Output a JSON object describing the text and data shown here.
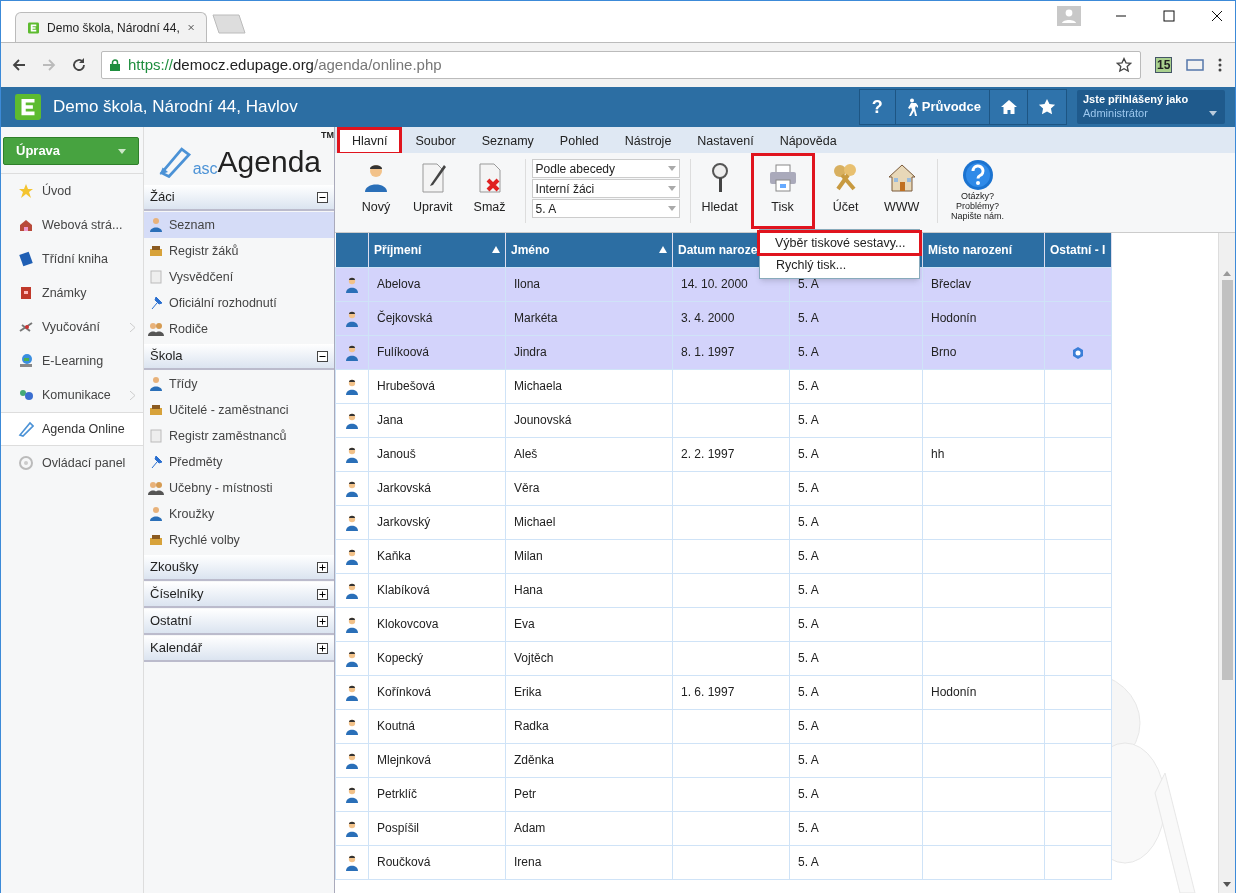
{
  "browser": {
    "tab_title": "Demo škola, Národní 44,",
    "url_scheme": "https://",
    "url_host": "democz.edupage.org",
    "url_path": "/agenda/online.php",
    "extension_badge": "15"
  },
  "header": {
    "title": "Demo škola, Národní 44, Havlov",
    "help": "?",
    "guide": "Průvodce",
    "user_label": "Jste přihlášený jako",
    "user_name": "Administrátor"
  },
  "nav": {
    "edit_button": "Úprava",
    "items": [
      {
        "label": "Úvod",
        "selected": false,
        "submenu": false
      },
      {
        "label": "Webová strá...",
        "selected": false,
        "submenu": false
      },
      {
        "label": "Třídní kniha",
        "selected": false,
        "submenu": false
      },
      {
        "label": "Známky",
        "selected": false,
        "submenu": false
      },
      {
        "label": "Vyučování",
        "selected": false,
        "submenu": true
      },
      {
        "label": "E-Learning",
        "selected": false,
        "submenu": false
      },
      {
        "label": "Komunikace",
        "selected": false,
        "submenu": true
      },
      {
        "label": "Agenda Online",
        "selected": true,
        "submenu": false
      },
      {
        "label": "Ovládací panel",
        "selected": false,
        "submenu": false
      }
    ]
  },
  "logo": {
    "prefix": "asc",
    "name": "Agenda",
    "mark": "TM"
  },
  "sections": [
    {
      "title": "Žáci",
      "expanded": true,
      "items": [
        {
          "label": "Seznam",
          "selected": true
        },
        {
          "label": "Registr žáků",
          "selected": false
        },
        {
          "label": "Vysvědčení",
          "selected": false
        },
        {
          "label": "Oficiální rozhodnutí",
          "selected": false
        },
        {
          "label": "Rodiče",
          "selected": false
        }
      ]
    },
    {
      "title": "Škola",
      "expanded": true,
      "items": [
        {
          "label": "Třídy",
          "selected": false
        },
        {
          "label": "Učitelé - zaměstnanci",
          "selected": false
        },
        {
          "label": "Registr zaměstnanců",
          "selected": false
        },
        {
          "label": "Předměty",
          "selected": false
        },
        {
          "label": "Učebny - místnosti",
          "selected": false
        },
        {
          "label": "Kroužky",
          "selected": false
        },
        {
          "label": "Rychlé volby",
          "selected": false
        }
      ]
    },
    {
      "title": "Zkoušky",
      "expanded": false
    },
    {
      "title": "Číselníky",
      "expanded": false
    },
    {
      "title": "Ostatní",
      "expanded": false
    },
    {
      "title": "Kalendář",
      "expanded": false
    }
  ],
  "menu_tabs": [
    {
      "label": "Hlavní",
      "selected": true,
      "highlighted": true
    },
    {
      "label": "Soubor",
      "selected": false,
      "highlighted": false
    },
    {
      "label": "Seznamy",
      "selected": false,
      "highlighted": false
    },
    {
      "label": "Pohled",
      "selected": false,
      "highlighted": false
    },
    {
      "label": "Nástroje",
      "selected": false,
      "highlighted": false
    },
    {
      "label": "Nastavení",
      "selected": false,
      "highlighted": false
    },
    {
      "label": "Nápověda",
      "selected": false,
      "highlighted": false
    }
  ],
  "toolbar_left": [
    {
      "label": "Nový",
      "highlighted": false
    },
    {
      "label": "Upravit",
      "highlighted": false
    },
    {
      "label": "Smaž",
      "highlighted": false
    }
  ],
  "filters": [
    "Podle abecedy",
    "Interní žáci",
    "5. A"
  ],
  "toolbar_right": [
    {
      "label": "Hledat",
      "highlighted": false
    },
    {
      "label": "Tisk",
      "highlighted": true
    },
    {
      "label": "Účet",
      "highlighted": false
    },
    {
      "label": "WWW",
      "highlighted": false
    }
  ],
  "help_lines": [
    "Otázky?",
    "Problémy?",
    "Napište nám."
  ],
  "print_menu": [
    {
      "label": "Výběr tiskové sestavy...",
      "highlighted": true
    },
    {
      "label": "Rychlý tisk...",
      "highlighted": false
    }
  ],
  "table": {
    "columns": [
      {
        "label": "Příjmení",
        "sorted": true
      },
      {
        "label": "Jméno",
        "sorted": true
      },
      {
        "label": "Datum naroze",
        "sorted": false
      },
      {},
      {
        "label": "Místo narození",
        "sorted": false
      },
      {
        "label": "Ostatní - I",
        "sorted": false
      }
    ],
    "rows": [
      {
        "cells": [
          "Abelova",
          "Ilona",
          "14. 10. 2000",
          "5. A",
          "Břeclav"
        ],
        "selected": true,
        "flagged": false
      },
      {
        "cells": [
          "Čejkovská",
          "Markéta",
          "3. 4. 2000",
          "5. A",
          "Hodonín"
        ],
        "selected": true,
        "flagged": false
      },
      {
        "cells": [
          "Fulíkoová",
          "Jindra",
          "8. 1. 1997",
          "5. A",
          "Brno"
        ],
        "selected": true,
        "flagged": true
      },
      {
        "cells": [
          "Hrubešová",
          "Michaela",
          "",
          "5. A",
          ""
        ],
        "selected": false,
        "flagged": false
      },
      {
        "cells": [
          "Jana",
          "Jounovská",
          "",
          "5. A",
          ""
        ],
        "selected": false,
        "flagged": false
      },
      {
        "cells": [
          "Janouš",
          "Aleš",
          "2. 2. 1997",
          "5. A",
          "hh"
        ],
        "selected": false,
        "flagged": false
      },
      {
        "cells": [
          "Jarkovská",
          "Věra",
          "",
          "5. A",
          ""
        ],
        "selected": false,
        "flagged": false
      },
      {
        "cells": [
          "Jarkovský",
          "Michael",
          "",
          "5. A",
          ""
        ],
        "selected": false,
        "flagged": false
      },
      {
        "cells": [
          "Kaňka",
          "Milan",
          "",
          "5. A",
          ""
        ],
        "selected": false,
        "flagged": false
      },
      {
        "cells": [
          "Klabíková",
          "Hana",
          "",
          "5. A",
          ""
        ],
        "selected": false,
        "flagged": false
      },
      {
        "cells": [
          "Klokovcova",
          "Eva",
          "",
          "5. A",
          ""
        ],
        "selected": false,
        "flagged": false
      },
      {
        "cells": [
          "Kopecký",
          "Vojtěch",
          "",
          "5. A",
          ""
        ],
        "selected": false,
        "flagged": false
      },
      {
        "cells": [
          "Kořínková",
          "Erika",
          "1. 6. 1997",
          "5. A",
          "Hodonín"
        ],
        "selected": false,
        "flagged": false
      },
      {
        "cells": [
          "Koutná",
          "Radka",
          "",
          "5. A",
          ""
        ],
        "selected": false,
        "flagged": false
      },
      {
        "cells": [
          "Mlejnková",
          "Zděnka",
          "",
          "5. A",
          ""
        ],
        "selected": false,
        "flagged": false
      },
      {
        "cells": [
          "Petrklíč",
          "Petr",
          "",
          "5. A",
          ""
        ],
        "selected": false,
        "flagged": false
      },
      {
        "cells": [
          "Pospíšil",
          "Adam",
          "",
          "5. A",
          ""
        ],
        "selected": false,
        "flagged": false
      },
      {
        "cells": [
          "Roučková",
          "Irena",
          "",
          "5. A",
          ""
        ],
        "selected": false,
        "flagged": false
      }
    ]
  }
}
